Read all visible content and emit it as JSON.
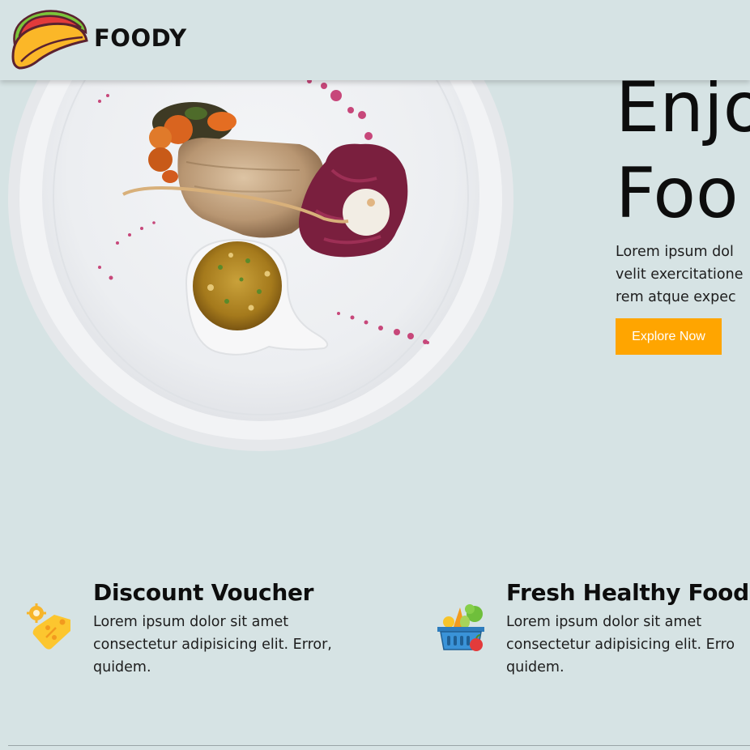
{
  "header": {
    "brand": "FOODY",
    "logo_icon": "taco-icon"
  },
  "hero": {
    "image_icon": "plated-dish-image",
    "title_lines": [
      "Enjo",
      "Foo"
    ],
    "description_lines": [
      "Lorem ipsum dol",
      "velit exercitatione",
      "rem atque expec"
    ],
    "cta_label": "Explore Now"
  },
  "features": [
    {
      "icon": "discount-tag-icon",
      "title": "Discount Voucher",
      "text_lines": [
        "Lorem ipsum dolor sit amet",
        "consectetur adipisicing elit. Error,",
        "quidem."
      ]
    },
    {
      "icon": "grocery-basket-icon",
      "title": "Fresh Healthy Food",
      "text_lines": [
        "Lorem ipsum dolor sit amet",
        "consectetur adipisicing elit. Erro",
        "quidem."
      ]
    }
  ],
  "colors": {
    "background": "#d6e3e4",
    "accent": "#ffa500",
    "text": "#111111"
  }
}
